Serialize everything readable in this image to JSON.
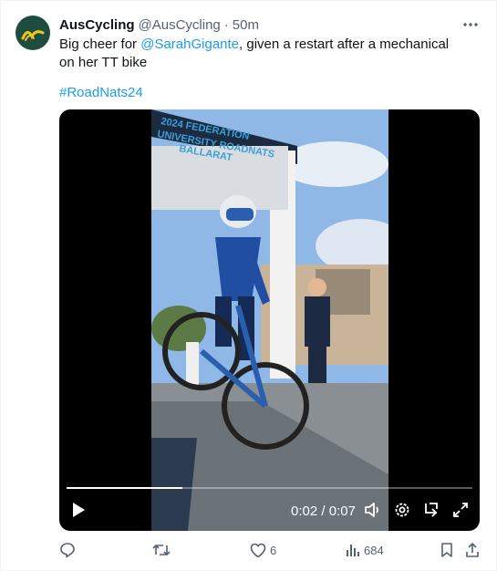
{
  "tweet": {
    "author_name": "AusCycling",
    "author_handle": "@AusCycling",
    "separator": "·",
    "time_ago": "50m",
    "text_before": "Big cheer for ",
    "mention": "@SarahGigante",
    "text_after": ", given a restart after a mechanical on her TT bike",
    "hashtag": "#RoadNats24"
  },
  "video": {
    "current_time": "0:02",
    "duration": "0:07",
    "time_separator": " / ",
    "progress_fraction": 0.286,
    "banner_text": "2024 FEDERATION UNIVERSITY ROADNATS BALLARAT"
  },
  "actions": {
    "reply_count": "",
    "repost_count": "",
    "like_count": "6",
    "views_count": "684"
  },
  "icons": [
    "logo-icon",
    "more-icon",
    "play-icon",
    "volume-icon",
    "settings-icon",
    "exit-icon",
    "fullscreen-icon",
    "reply-icon",
    "repost-icon",
    "like-icon",
    "views-icon",
    "bookmark-icon",
    "share-icon"
  ],
  "colors": {
    "link": "#1d9bf0",
    "secondary": "#536471",
    "avatar_bg": "#1d4d3f",
    "avatar_mark": "#f5c518"
  }
}
